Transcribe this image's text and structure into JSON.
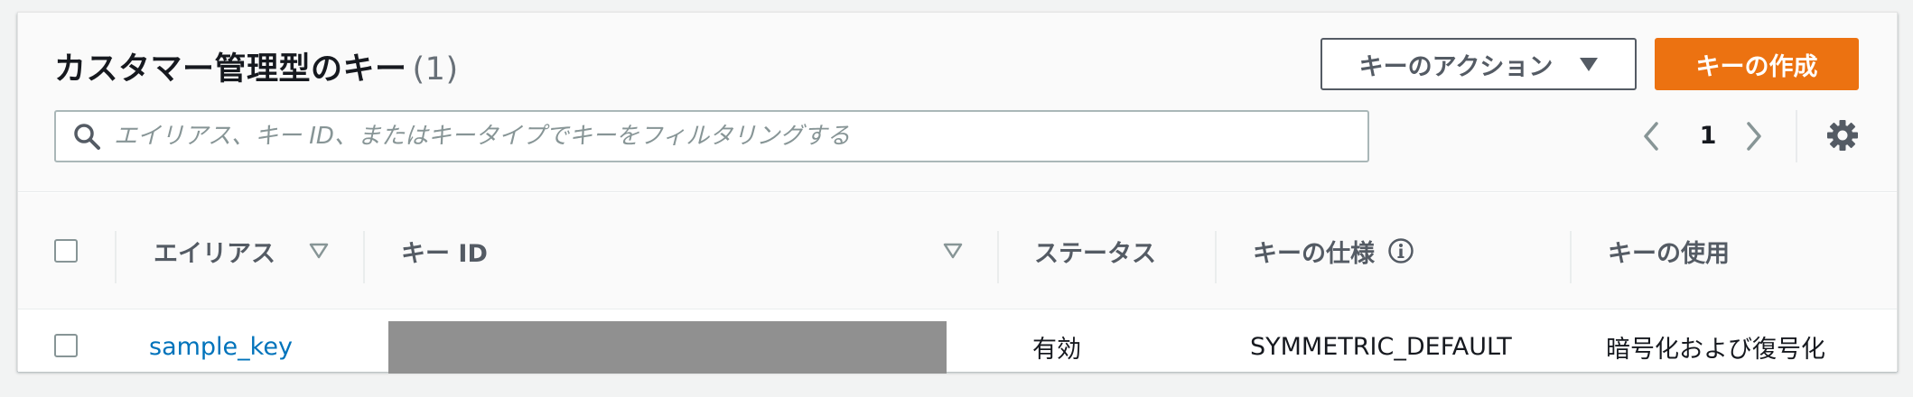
{
  "header": {
    "title": "カスタマー管理型のキー",
    "count": "(1)",
    "actions_label": "キーのアクション",
    "create_label": "キーの作成"
  },
  "search": {
    "placeholder": "エイリアス、キー ID、またはキータイプでキーをフィルタリングする",
    "value": ""
  },
  "pagination": {
    "current_page": "1"
  },
  "table": {
    "columns": [
      {
        "label": "エイリアス",
        "sortable": true
      },
      {
        "label": "キー ID",
        "sortable": true
      },
      {
        "label": "ステータス",
        "sortable": false
      },
      {
        "label": "キーの仕様",
        "info": true
      },
      {
        "label": "キーの使用",
        "sortable": false
      }
    ],
    "rows": [
      {
        "alias": "sample_key",
        "key_id": "",
        "key_id_redacted": true,
        "status": "有効",
        "key_spec": "SYMMETRIC_DEFAULT",
        "key_usage": "暗号化および復号化"
      }
    ]
  },
  "icons": {
    "search": "search-icon",
    "prev": "chevron-left-icon",
    "next": "chevron-right-icon",
    "settings": "gear-icon",
    "info": "info-icon",
    "sort": "sort-triangle-icon",
    "dropdown": "caret-down-icon"
  },
  "colors": {
    "primary_button": "#ec7211",
    "link": "#0073bb",
    "redaction": "#909090"
  }
}
